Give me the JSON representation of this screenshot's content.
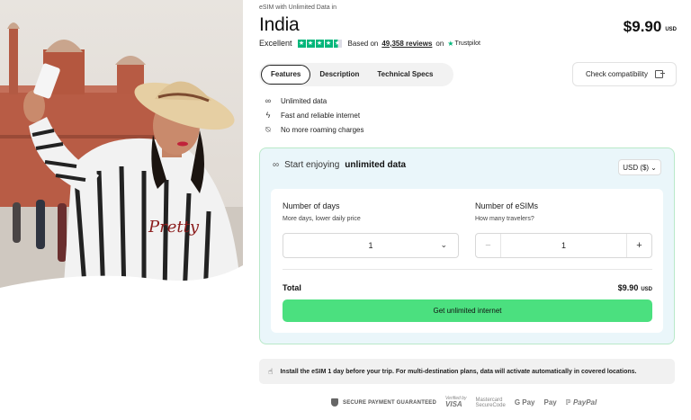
{
  "product": {
    "eyebrow": "eSIM with Unlimited Data in",
    "title": "India",
    "price": "$9.90",
    "price_currency": "USD"
  },
  "rating": {
    "label": "Excellent",
    "stars": 4.5,
    "based_on": "Based on",
    "reviews": "49,358 reviews",
    "on": "on",
    "provider": "Trustpilot"
  },
  "tabs": [
    {
      "label": "Features",
      "active": true
    },
    {
      "label": "Description",
      "active": false
    },
    {
      "label": "Technical Specs",
      "active": false
    }
  ],
  "compat_button": "Check compatibility",
  "features": [
    {
      "icon": "infinity-icon",
      "text": "Unlimited data"
    },
    {
      "icon": "lightning-icon",
      "text": "Fast and reliable internet"
    },
    {
      "icon": "no-roaming-icon",
      "text": "No more roaming charges"
    }
  ],
  "purchase": {
    "heading_prefix": "Start enjoying",
    "heading_bold": "unlimited data",
    "currency_selector": "USD ($)",
    "days_label": "Number of days",
    "days_sub": "More days, lower daily price",
    "days_value": "1",
    "esims_label": "Number of eSIMs",
    "esims_sub": "How many travelers?",
    "esims_value": "1",
    "total_label": "Total",
    "total_value": "$9.90",
    "total_currency": "USD",
    "cta": "Get unlimited internet"
  },
  "notice": "Install the eSIM 1 day before your trip. For multi-destination plans, data will activate automatically in covered locations.",
  "payments": {
    "secure": "SECURE PAYMENT GUARANTEED",
    "verified_by": "Verified by",
    "visa": "VISA",
    "mastercard": "Mastercard",
    "securecode": "SecureCode",
    "gpay": "G Pay",
    "apay": "Pay",
    "paypal": "PayPal"
  },
  "colors": {
    "accent_green": "#4be07f",
    "trustpilot_green": "#00b67a",
    "box_background": "#eaf6fa",
    "box_border": "#b9e9c9"
  }
}
